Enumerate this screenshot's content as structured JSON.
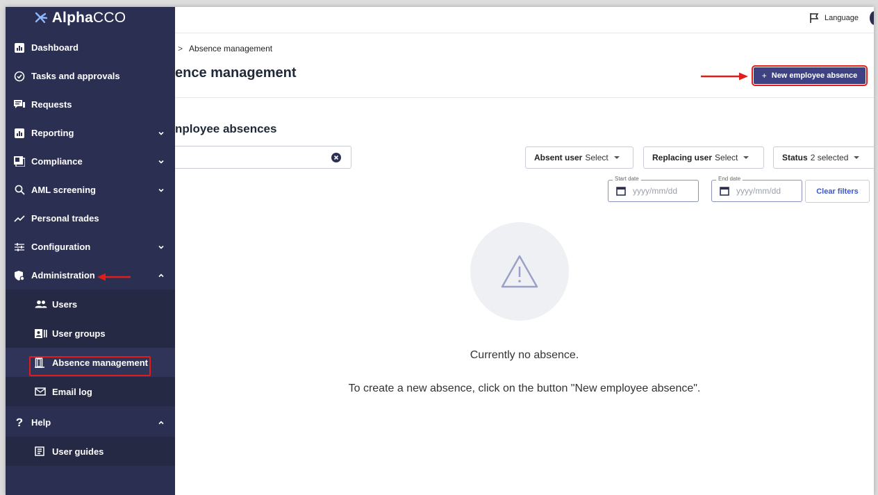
{
  "app": {
    "logo_text_bold": "Alpha",
    "logo_text_thin": "CCO"
  },
  "sidebar": {
    "items": [
      {
        "label": "Dashboard",
        "icon": "bar-chart-icon"
      },
      {
        "label": "Tasks and approvals",
        "icon": "check-circle-icon"
      },
      {
        "label": "Requests",
        "icon": "chat-icon"
      },
      {
        "label": "Reporting",
        "icon": "bar-chart-icon",
        "expandable": true
      },
      {
        "label": "Compliance",
        "icon": "document-icon",
        "expandable": true
      },
      {
        "label": "AML screening",
        "icon": "search-icon",
        "expandable": true
      },
      {
        "label": "Personal trades",
        "icon": "trend-line-icon"
      },
      {
        "label": "Configuration",
        "icon": "sliders-icon",
        "expandable": true
      },
      {
        "label": "Administration",
        "icon": "shield-gear-icon",
        "expandable": true,
        "expanded": true
      }
    ],
    "admin_sub": [
      {
        "label": "Users",
        "icon": "people-icon"
      },
      {
        "label": "User groups",
        "icon": "id-card-icon"
      },
      {
        "label": "Absence management",
        "icon": "door-icon",
        "active": true
      },
      {
        "label": "Email log",
        "icon": "mail-icon"
      }
    ],
    "help": {
      "label": "Help",
      "icon": "question-icon",
      "expanded": true
    },
    "help_sub": [
      {
        "label": "User guides",
        "icon": "book-icon"
      }
    ]
  },
  "topbar": {
    "language_label": "Language"
  },
  "breadcrumb": {
    "sep": ">",
    "current": "Absence management"
  },
  "page": {
    "title": "ence management",
    "new_button": "New employee absence",
    "new_button_plus": "+",
    "section_title": "nployee absences"
  },
  "filters": {
    "absent_user": {
      "label": "Absent user",
      "value": "Select"
    },
    "replacing_user": {
      "label": "Replacing user",
      "value": "Select"
    },
    "status": {
      "label": "Status",
      "value": "2 selected"
    },
    "start_date": {
      "legend": "Start date",
      "placeholder": "yyyy/mm/dd"
    },
    "end_date": {
      "legend": "End date",
      "placeholder": "yyyy/mm/dd"
    },
    "clear_label": "Clear filters"
  },
  "empty_state": {
    "title": "Currently no absence.",
    "description": "To create a new absence, click on the button \"New employee absence\"."
  },
  "colors": {
    "sidebar_bg": "#2b2f52",
    "primary_button": "#3e4283",
    "annotation_red": "#e21b1b",
    "link_blue": "#3a57c9"
  }
}
